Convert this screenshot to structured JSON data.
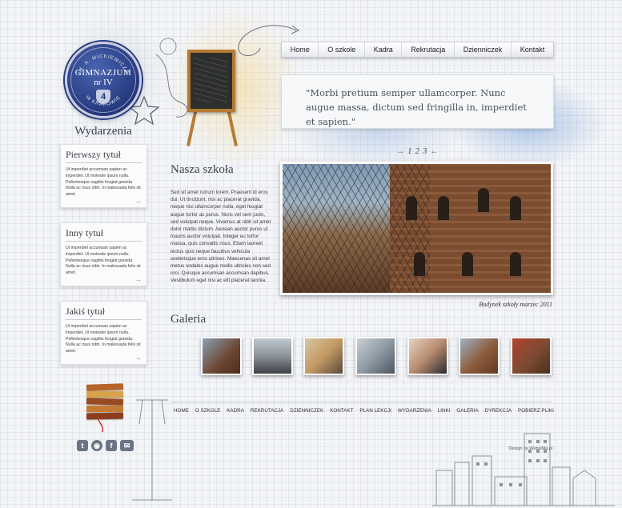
{
  "logo": {
    "arc_top": "IM. A. MICKIEWICZA",
    "arc_bottom": "W KRAKOWIE",
    "line1": "GIMNAZJUM",
    "line2": "nr IV",
    "number": "4"
  },
  "nav": {
    "items": [
      "Home",
      "O szkole",
      "Kadra",
      "Rekrutacja",
      "Dzienniczek",
      "Kontakt"
    ]
  },
  "quote": "\"Morbi pretium semper ullamcorper. Nunc augue massa, dictum sed fringilla in, imperdiet et sapien.\"",
  "pager": {
    "prev": "→",
    "pages": [
      "1",
      "2",
      "3"
    ],
    "next": "←"
  },
  "sidebar": {
    "title": "Wydarzenia",
    "cards": [
      {
        "title": "Pierwszy tytuł",
        "text": "Ut imperdiet accumsan sapien ac imperdiet. Ut molestie ipsum nulla. Pellentesque sagittis feugiat gravida. Nulla ac risus nibh. In malesuada felis sit amet."
      },
      {
        "title": "Inny tytuł",
        "text": "Ut imperdiet accumsan sapien ac imperdiet. Ut molestie ipsum nulla. Pellentesque sagittis feugiat gravida. Nulla ac risus nibh. In malesuada felis sit amet."
      },
      {
        "title": "Jakiś tytuł",
        "text": "Ut imperdiet accumsan sapien ac imperdiet. Ut molestie ipsum nulla. Pellentesque sagittis feugiat gravida. Nulla ac risus nibh. In malesuada felis sit amet."
      }
    ],
    "arrow": "→"
  },
  "main": {
    "heading": "Nasza szkoła",
    "text": "Sed sit amet rutrum lorem. Praesent id eros dui. Ut tincidunt, nisi ac placerat gravida, neque nisi ullamcorper nulla, eget feugiat augue tortor ac purus. Nunc vel sem justo, sed volutpat neque. Vivamus at nibh sit amet dolor mattis dictum. Aenean auctor purus ut mauris auctor volutpat. Integer eu tortor massa, quis convallis risus. Etiam laoreet lectus quis neque faucibus vehicula scelerisque eros ultrices. Maecenas sit amet metus sodales augue mollis ultricies non sed orci. Quisque accumsan accumsan dapibus. Vestibulum eget nisi ac elit placerat lacinia.",
    "caption": "Budynek szkoły marzec 2011"
  },
  "gallery": {
    "heading": "Galeria"
  },
  "footer": {
    "items": [
      "HOME",
      "O SZKOLE",
      "KADRA",
      "REKRUTACJA",
      "DZIENNICZEK",
      "KONTAKT",
      "PLAN LEKCJI",
      "WYDARZENIA",
      "LINKI",
      "GALERIA",
      "DYREKCJA",
      "POBIERZ PLIKI"
    ],
    "design_by": "Design by WebsiMa.pl"
  },
  "social": {
    "twitter": "t",
    "rss": "◉",
    "facebook": "f",
    "mail": "✉"
  },
  "icons": [
    "star-icon",
    "twitter-icon",
    "rss-icon",
    "facebook-icon",
    "mail-icon",
    "arrow-right-icon",
    "arrow-left-icon"
  ],
  "colors": {
    "badge": "#22357a",
    "board_frame": "#b57a34",
    "text": "#3a3f4a"
  }
}
